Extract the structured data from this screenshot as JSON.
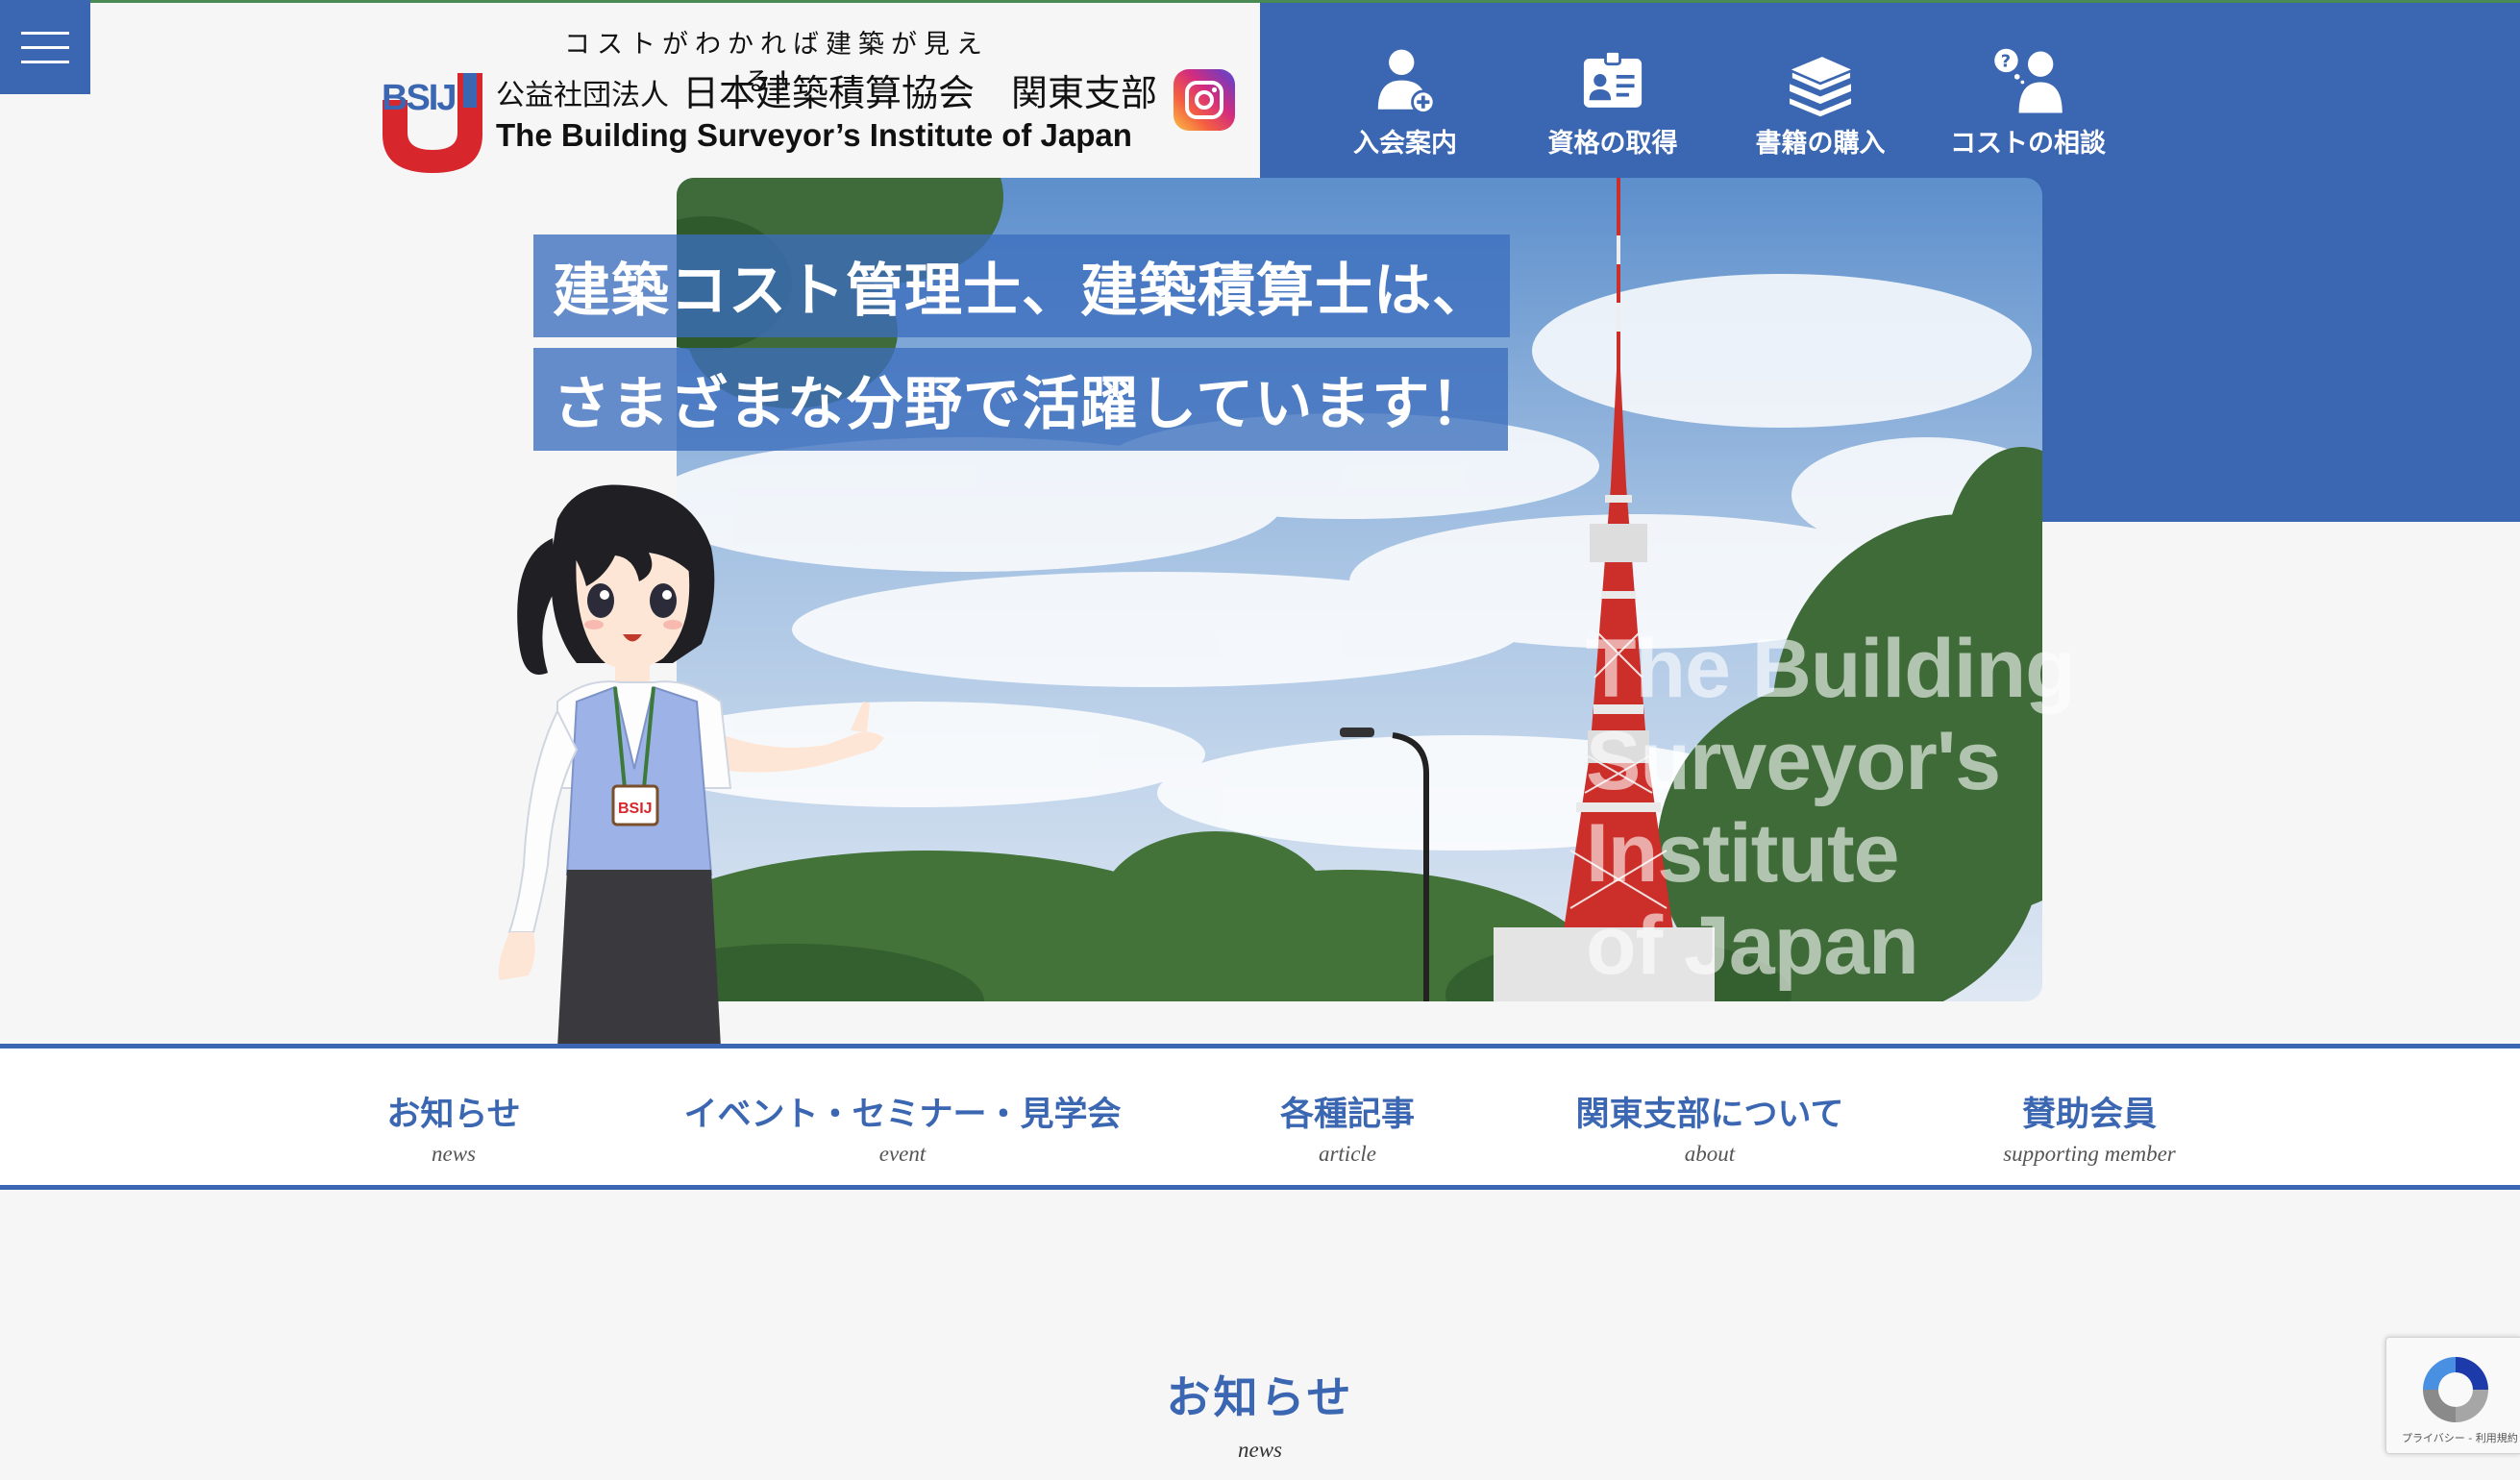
{
  "header": {
    "tagline": "コストがわかれば建築が見える！",
    "org_prefix": "公益社団法人",
    "org_name": "日本建築積算協会　関東支部",
    "org_english": "The Building Surveyor’s Institute of Japan",
    "logo_text": "BSIJ",
    "menu_icon": "hamburger-menu-icon",
    "social_icon": "instagram-icon"
  },
  "top_nav": [
    {
      "label": "入会案内",
      "icon": "person-plus-icon"
    },
    {
      "label": "資格の取得",
      "icon": "id-card-icon"
    },
    {
      "label": "書籍の購入",
      "icon": "books-icon"
    },
    {
      "label": "コストの相談",
      "icon": "question-person-icon"
    }
  ],
  "hero": {
    "line1": "建築コスト管理士、建築積算士は、",
    "line2": "さまざまな分野で活躍しています！",
    "watermark_lines": [
      "The Building",
      "Surveyor's",
      "Institute",
      "of Japan"
    ],
    "badge_text": "BSIJ"
  },
  "main_nav": [
    {
      "jp": "お知らせ",
      "en": "news"
    },
    {
      "jp": "イベント・セミナー・見学会",
      "en": "event"
    },
    {
      "jp": "各種記事",
      "en": "article"
    },
    {
      "jp": "関東支部について",
      "en": "about"
    },
    {
      "jp": "賛助会員",
      "en": "supporting member"
    }
  ],
  "news_section": {
    "title": "お知らせ",
    "subtitle": "news"
  },
  "recaptcha": {
    "links": "プライバシー - 利用規約"
  },
  "colors": {
    "brand_blue": "#3b66b1",
    "logo_red": "#d7262c",
    "background": "#f6f6f7"
  }
}
